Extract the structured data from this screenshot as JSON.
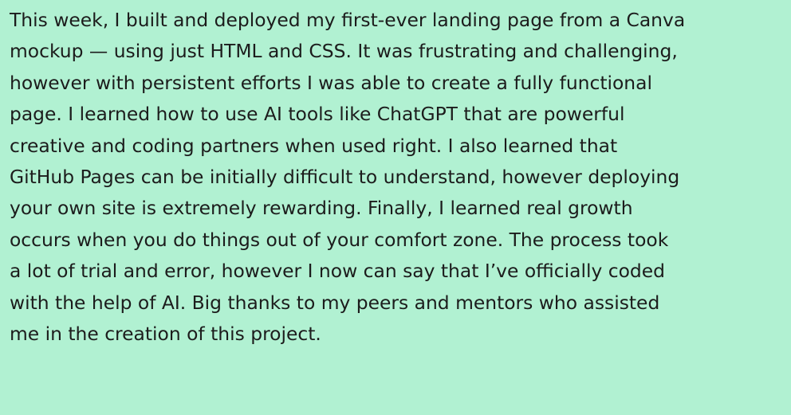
{
  "post": {
    "lines": [
      "This week, I built and deployed my first-ever landing page from a Canva",
      "mockup — using just HTML and CSS. It was frustrating and challenging,",
      "however with persistent efforts I was able to create a fully functional",
      "page. I learned how to use AI tools like ChatGPT that are powerful",
      "creative and coding partners when used right. I also learned that",
      "GitHub Pages can be initially difficult to understand, however deploying",
      "your own site is extremely rewarding. Finally, I learned real growth",
      "occurs when you do things out of your comfort zone. The process took",
      "a lot of trial and error, however I now can say that I’ve officially coded",
      "with the help of AI. Big thanks to my peers and mentors who assisted",
      "me in the creation of this project."
    ]
  }
}
